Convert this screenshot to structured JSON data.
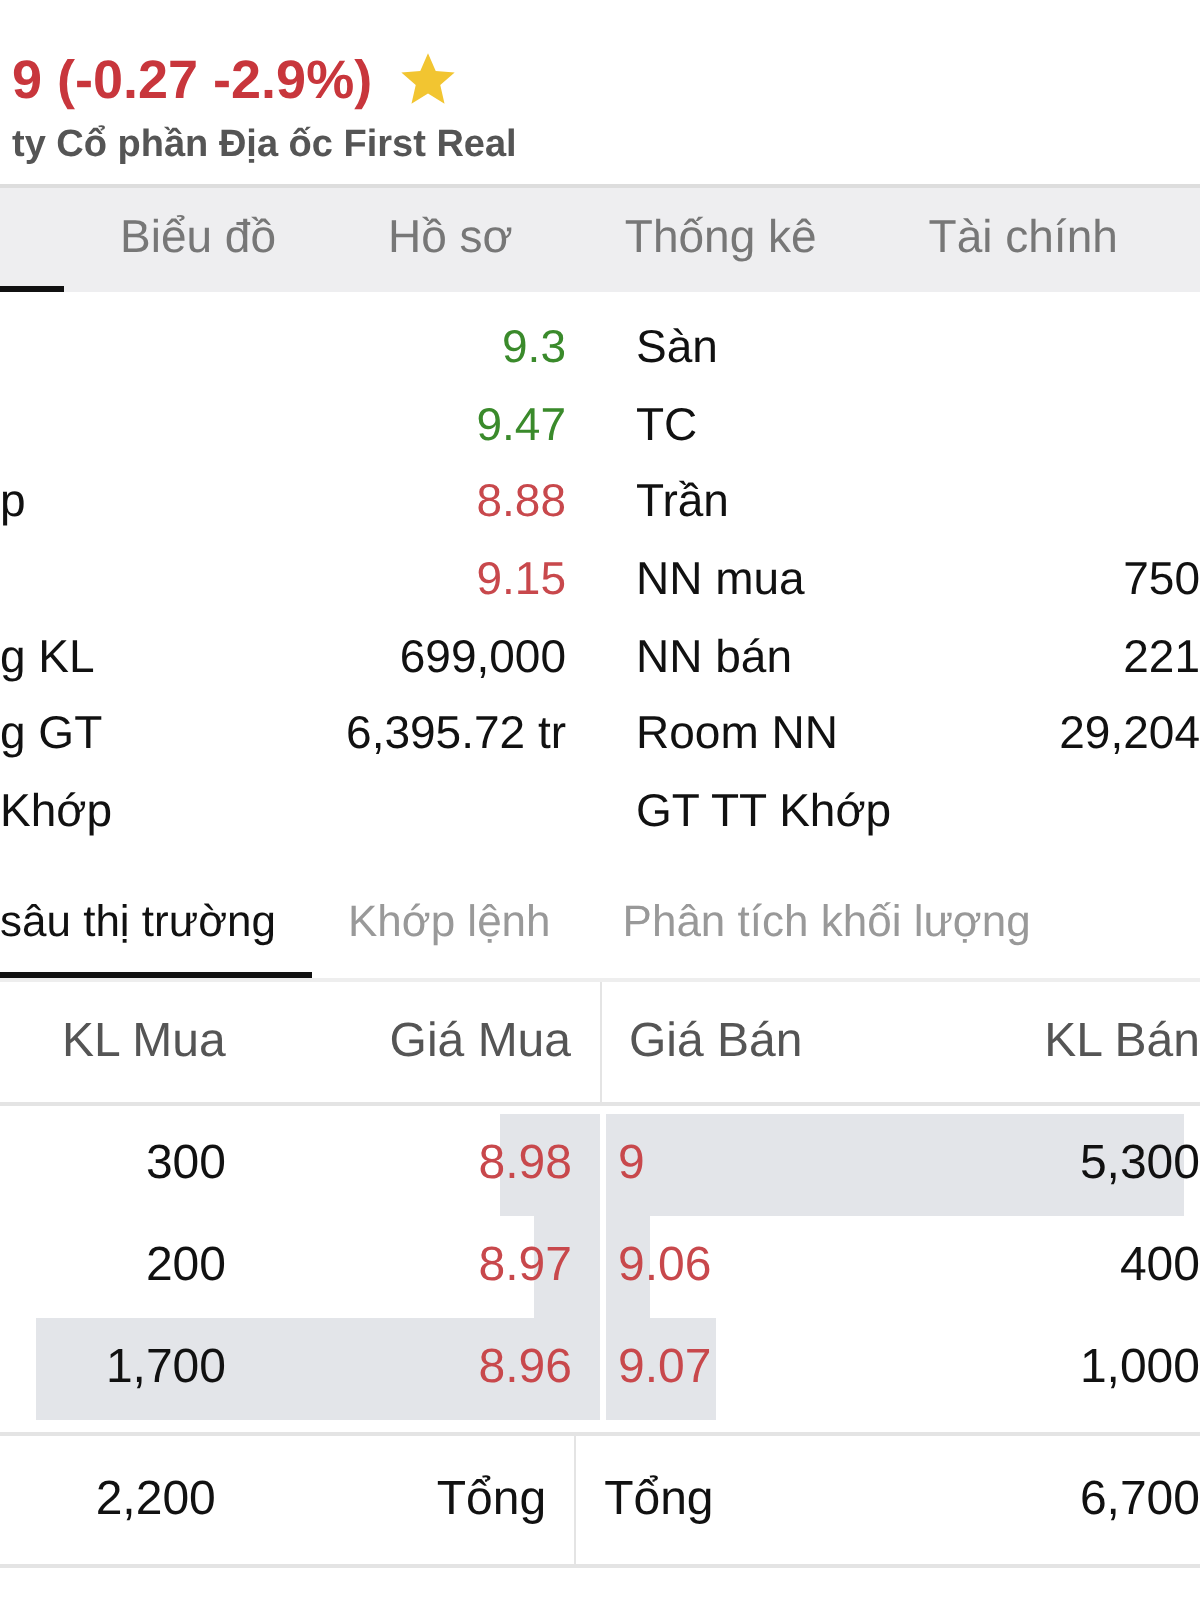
{
  "header": {
    "price": "9 (-0.27 -2.9%)",
    "favorite": true,
    "company": "ty Cổ phần Địa ốc First Real"
  },
  "tabs": [
    {
      "selected": true
    },
    {
      "label": "Biểu đồ",
      "selected": false
    },
    {
      "label": "Hồ sơ",
      "selected": false
    },
    {
      "label": "Thống kê",
      "selected": false
    },
    {
      "label": "Tài chính",
      "selected": false
    }
  ],
  "stats_left": [
    {
      "value": "9.3",
      "color": "#3a8a2b"
    },
    {
      "value": "9.47",
      "color": "#3a8a2b"
    },
    {
      "label": "p",
      "value": "8.88",
      "color": "#c8484c"
    },
    {
      "value": "9.15",
      "color": "#c8484c"
    },
    {
      "label": "g KL",
      "value": "699,000",
      "color": "#111111"
    },
    {
      "label": "g GT",
      "value": "6,395.72 tr",
      "color": "#111111"
    },
    {
      "label": "Khớp"
    }
  ],
  "stats_right": [
    {
      "label": "Sàn"
    },
    {
      "label": "TC"
    },
    {
      "label": "Trần"
    },
    {
      "label": "NN mua",
      "value": "750"
    },
    {
      "label": "NN bán",
      "value": "221"
    },
    {
      "label": "Room NN",
      "value": "29,204"
    },
    {
      "label": "GT TT Khớp"
    }
  ],
  "sub_tabs": [
    {
      "label": "sâu thị trường",
      "selected": true
    },
    {
      "label": "Khớp lệnh",
      "selected": false
    },
    {
      "label": "Phân tích khối lượng",
      "selected": false
    }
  ],
  "order_book": {
    "columns": [
      "KL Mua",
      "Giá Mua",
      "Giá Bán",
      "KL Bán"
    ],
    "rows": [
      {
        "buy": {
          "volume": "300",
          "price": "8.98"
        },
        "sell": {
          "price": "9",
          "volume": "5,300"
        }
      },
      {
        "buy": {
          "volume": "200",
          "price": "8.97"
        },
        "sell": {
          "price": "9.06",
          "volume": "400"
        }
      },
      {
        "buy": {
          "volume": "1,700",
          "price": "8.96"
        },
        "sell": {
          "price": "9.07",
          "volume": "1,000"
        }
      }
    ],
    "total": {
      "buy_volume": "2,200",
      "buy_label": "Tổng",
      "sell_label": "Tổng",
      "sell_volume": "6,700"
    }
  }
}
